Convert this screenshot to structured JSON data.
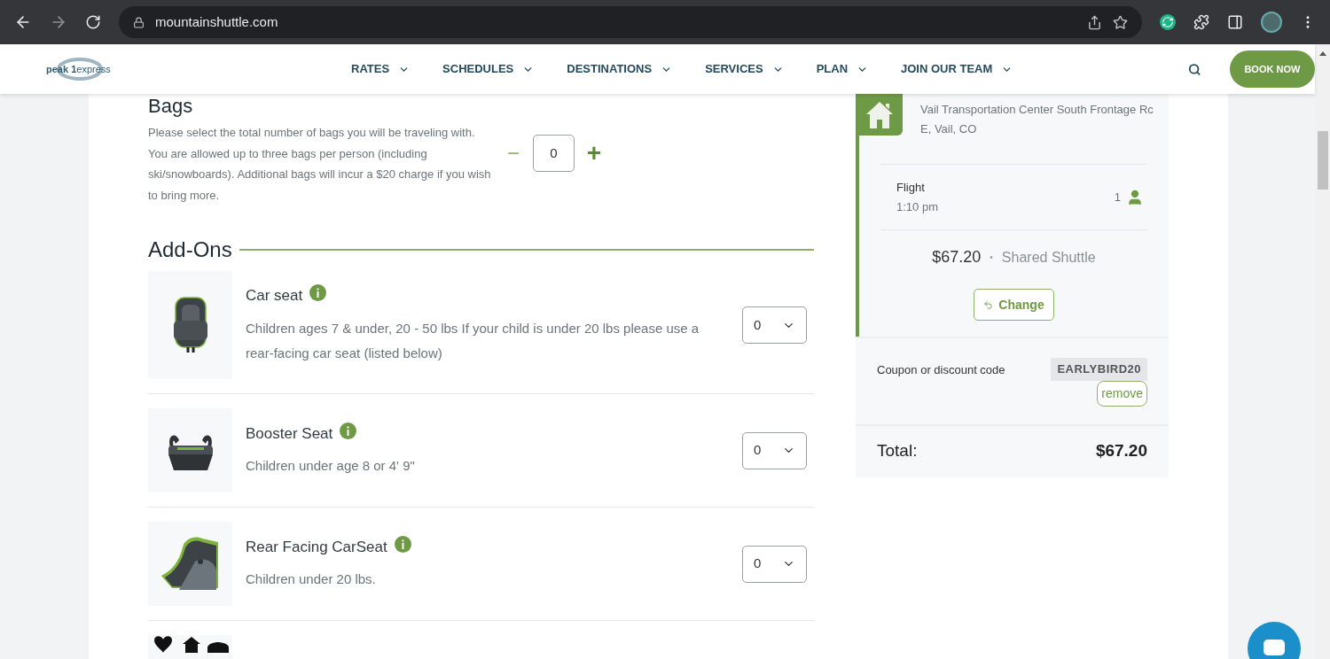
{
  "browser": {
    "url": "mountainshuttle.com"
  },
  "site_header": {
    "logo": {
      "word_1": "peak",
      "word_2": "1",
      "word_3": "express"
    },
    "nav": [
      {
        "label": "RATES"
      },
      {
        "label": "SCHEDULES"
      },
      {
        "label": "DESTINATIONS"
      },
      {
        "label": "SERVICES"
      },
      {
        "label": "PLAN"
      },
      {
        "label": "JOIN OUR TEAM"
      }
    ],
    "book_button": "BOOK NOW"
  },
  "bags": {
    "title": "Bags",
    "description": "Please select the total number of bags you will be traveling with. You are allowed up to three bags per person (including ski/snowboards). Additional bags will incur a $20 charge if you wish to bring more.",
    "minus": "−",
    "value": "0",
    "plus": "+"
  },
  "addons": {
    "title": "Add-Ons",
    "items": [
      {
        "kind": "car_seat",
        "name": "Car seat",
        "description": "Children ages 7 & under, 20 - 50 lbs If your child is under 20 lbs please use a rear-facing car seat (listed below)",
        "quantity": "0"
      },
      {
        "kind": "booster",
        "name": "Booster Seat",
        "description": "Children under age 8 or 4' 9\"",
        "quantity": "0"
      },
      {
        "kind": "rear_facing",
        "name": "Rear Facing CarSeat",
        "description": "Children under 20 lbs.",
        "quantity": "0"
      },
      {
        "kind": "partial"
      }
    ]
  },
  "summary": {
    "address_line_1": "Vail Transportation Center South Frontage Rc",
    "address_line_2": "E, Vail, CO",
    "flight_label": "Flight",
    "flight_time": "1:10 pm",
    "passengers": "1",
    "price": "$67.20",
    "separator": "•",
    "service": "Shared Shuttle",
    "change_button": "Change",
    "coupon_label": "Coupon or discount code",
    "coupon_code": "EARLYBIRD20",
    "remove_button": "remove",
    "total_label": "Total:",
    "total_value": "$67.20"
  }
}
